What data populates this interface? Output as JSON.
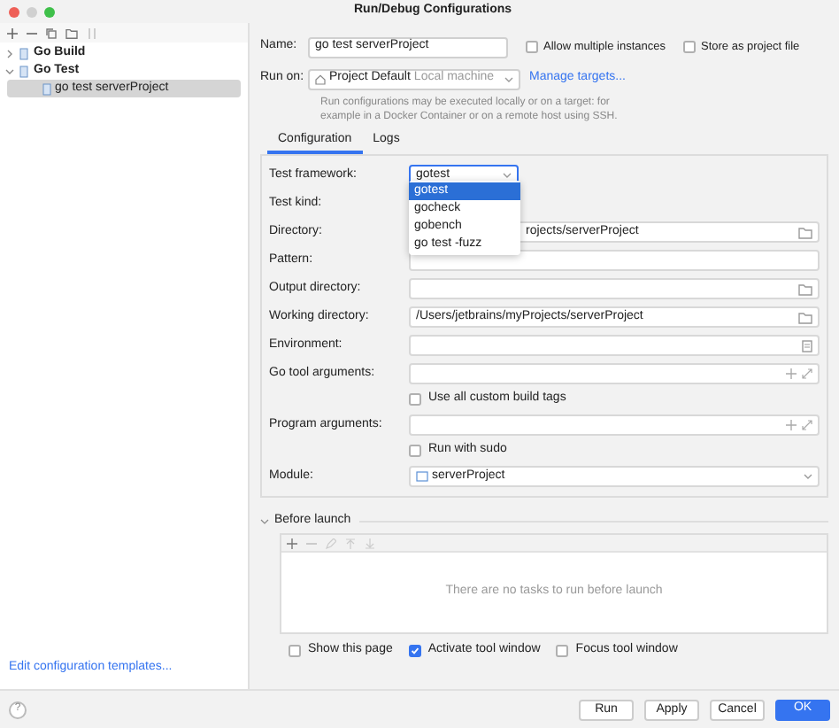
{
  "window": {
    "title": "Run/Debug Configurations"
  },
  "tree": [
    {
      "label": "Go Build",
      "expanded": false,
      "selected": false
    },
    {
      "label": "Go Test",
      "expanded": true,
      "selected": false,
      "children": [
        {
          "label": "go test serverProject",
          "selected": true
        }
      ]
    }
  ],
  "templates_link": "Edit configuration templates...",
  "help": "?",
  "name": {
    "label": "Name:",
    "value": "go test serverProject"
  },
  "options": [
    {
      "label": "Allow multiple instances",
      "checked": false
    },
    {
      "label": "Store as project file",
      "checked": false
    }
  ],
  "run_on": {
    "label": "Run on:",
    "target": "Project Default",
    "detail": "Local machine",
    "link": "Manage targets...",
    "hint": "Run configurations may be executed locally or on a target: for example in a Docker Container or on a remote host using SSH."
  },
  "tabs": [
    {
      "label": "Configuration",
      "selected": true
    },
    {
      "label": "Logs",
      "selected": false
    }
  ],
  "form": [
    {
      "kind": "select",
      "label": "Test framework:",
      "value": "gotest"
    },
    {
      "kind": "blank",
      "label": "Test kind:"
    },
    {
      "kind": "folder",
      "label": "Directory:",
      "value": "rojects/serverProject"
    },
    {
      "kind": "text",
      "label": "Pattern:"
    },
    {
      "kind": "folder",
      "label": "Output directory:"
    },
    {
      "kind": "folder",
      "label": "Working directory:",
      "value": "/Users/jetbrains/myProjects/serverProject"
    },
    {
      "kind": "env",
      "label": "Environment:"
    },
    {
      "kind": "args",
      "label": "Go tool arguments:"
    },
    {
      "kind": "checkbox",
      "label": "Use all custom build tags",
      "checked": false
    },
    {
      "kind": "args",
      "label": "Program arguments:"
    },
    {
      "kind": "checkbox",
      "label": "Run with sudo",
      "checked": false
    },
    {
      "kind": "module",
      "label": "Module:",
      "value": "serverProject"
    }
  ],
  "dropdown": [
    {
      "label": "gotest",
      "selected": true
    },
    {
      "label": "gocheck",
      "selected": false
    },
    {
      "label": "gobench",
      "selected": false
    },
    {
      "label": "go test -fuzz",
      "selected": false
    }
  ],
  "before_launch": {
    "title": "Before launch",
    "expanded": true,
    "empty_text": "There are no tasks to run before launch",
    "options": [
      {
        "label": "Show this page",
        "checked": false
      },
      {
        "label": "Activate tool window",
        "checked": true
      },
      {
        "label": "Focus tool window",
        "checked": false
      }
    ]
  },
  "buttons": [
    {
      "label": "Run",
      "primary": false
    },
    {
      "label": "Apply",
      "primary": false
    },
    {
      "label": "Cancel",
      "primary": false
    },
    {
      "label": "OK",
      "primary": true
    }
  ]
}
